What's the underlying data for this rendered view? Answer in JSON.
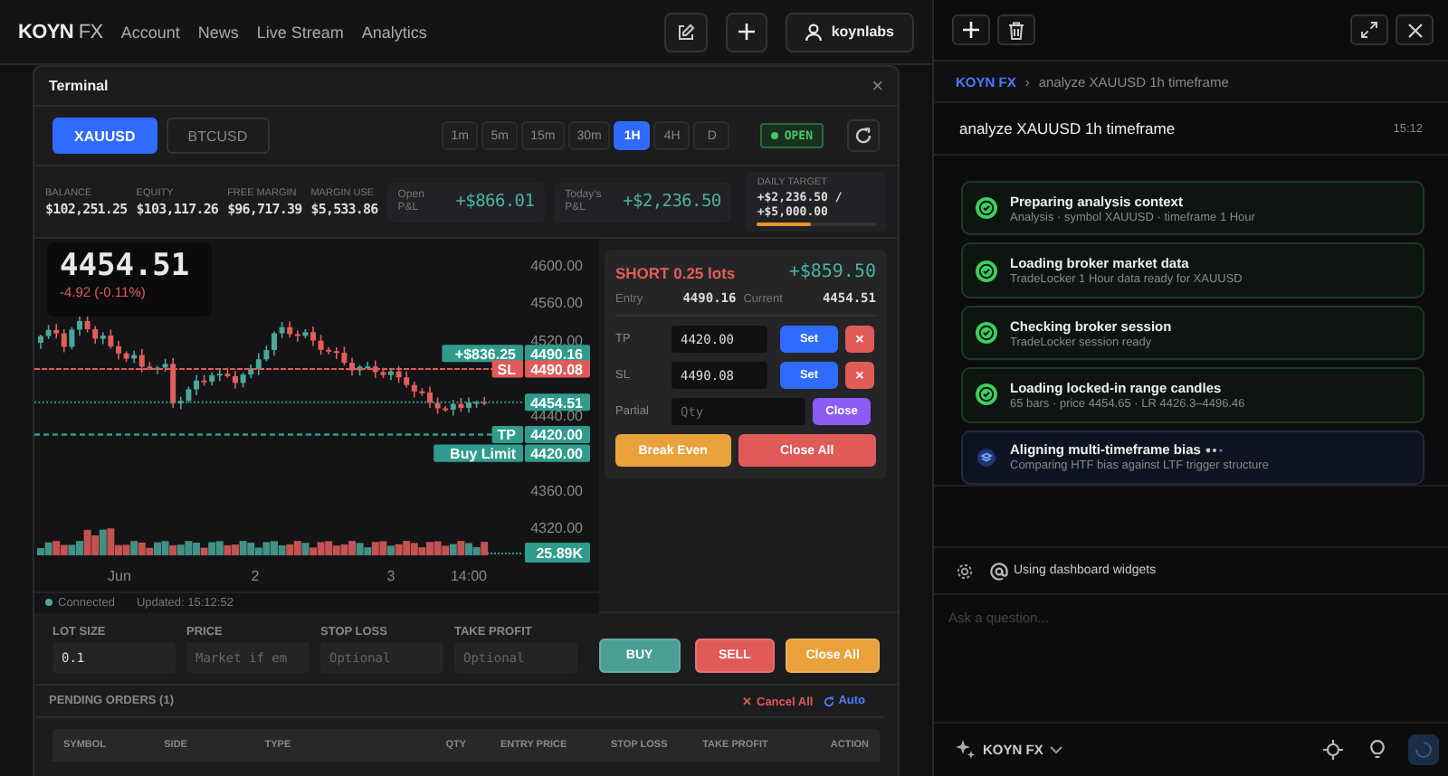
{
  "top_bar": {
    "logo_main": "KOYN",
    "logo_sub": "FX",
    "nav": [
      {
        "label": "Account"
      },
      {
        "label": "News"
      },
      {
        "label": "Live Stream"
      },
      {
        "label": "Analytics"
      }
    ],
    "user": "koynlabs"
  },
  "terminal": {
    "title": "Terminal",
    "close": "×",
    "symbols": [
      {
        "label": "XAUUSD",
        "selected": true
      },
      {
        "label": "BTCUSD",
        "selected": false
      }
    ],
    "timeframes": [
      {
        "label": "1m",
        "selected": false
      },
      {
        "label": "5m",
        "selected": false
      },
      {
        "label": "15m",
        "selected": false
      },
      {
        "label": "30m",
        "selected": false
      },
      {
        "label": "1H",
        "selected": true
      },
      {
        "label": "4H",
        "selected": false
      },
      {
        "label": "D",
        "selected": false
      }
    ],
    "market_status": "OPEN",
    "stats": [
      {
        "label": "BALANCE",
        "value": "$102,251.25"
      },
      {
        "label": "EQUITY",
        "value": "$103,117.26"
      },
      {
        "label": "FREE MARGIN",
        "value": "$96,717.39"
      },
      {
        "label": "MARGIN USE",
        "value": "$5,533.86"
      }
    ],
    "pnl": [
      {
        "label": "Open P&L",
        "value": "+$866.01"
      },
      {
        "label": "Today's P&L",
        "value": "+$2,236.50"
      }
    ],
    "daily_target": {
      "label": "DAILY TARGET",
      "value": "+$2,236.50 / +$5,000.00",
      "level": 0.45
    },
    "chart": {
      "price": "4454.51",
      "change": "-4.92 (-0.11%)",
      "y_axis_labels": [
        "4600.00",
        "4560.00",
        "4520.00",
        "4440.00",
        "4360.00",
        "4320.00"
      ],
      "x_axis_labels": [
        "Jun",
        "2",
        "3",
        "14:00"
      ],
      "price_tags": [
        {
          "kind": "position",
          "label": "+$836.25",
          "value": "4490.16"
        },
        {
          "kind": "stop",
          "label": "SL",
          "value": "4490.08"
        },
        {
          "kind": "current",
          "value": "4454.51"
        },
        {
          "kind": "target",
          "label": "TP",
          "value": "4420.00"
        },
        {
          "kind": "order",
          "label": "Buy Limit",
          "value": "4420.00"
        }
      ],
      "volume_tag": "25.89K",
      "connection": "Connected",
      "updated": "Updated: 15:12:52"
    },
    "position": {
      "side": "SHORT 0.25 lots",
      "pnl": "+$859.50",
      "entry_label": "Entry",
      "entry": "4490.16",
      "current_label": "Current",
      "current": "4454.51",
      "rows": [
        {
          "label": "TP",
          "value": "4420.00",
          "set": "Set",
          "clear": "×"
        },
        {
          "label": "SL",
          "value": "4490.08",
          "set": "Set",
          "clear": "×"
        }
      ],
      "partial": {
        "label": "Partial",
        "placeholder": "Qty",
        "button": "Close"
      },
      "break_even": "Break Even",
      "close_all": "Close All"
    },
    "order_form": {
      "fields": [
        {
          "label": "LOT SIZE",
          "value": "0.1"
        },
        {
          "label": "PRICE",
          "placeholder": "Market if em"
        },
        {
          "label": "STOP LOSS",
          "placeholder": "Optional"
        },
        {
          "label": "TAKE PROFIT",
          "placeholder": "Optional"
        }
      ],
      "buttons": [
        {
          "kind": "buy",
          "label": "BUY"
        },
        {
          "kind": "sell",
          "label": "SELL"
        },
        {
          "kind": "close",
          "label": "Close All"
        }
      ]
    },
    "pending_orders": {
      "title": "PENDING ORDERS (1)",
      "cancel_all": "✕ Cancel All",
      "auto": "Auto",
      "columns": [
        "SYMBOL",
        "SIDE",
        "TYPE",
        "QTY",
        "ENTRY PRICE",
        "STOP LOSS",
        "TAKE PROFIT",
        "ACTION"
      ]
    }
  },
  "chat": {
    "breadcrumb": {
      "root": "KOYN FX",
      "separator": "›",
      "current": "analyze XAUUSD 1h timeframe"
    },
    "message": {
      "text": "analyze XAUUSD 1h timeframe",
      "time": "15:12"
    },
    "steps": [
      {
        "kind": "done",
        "title": "Preparing analysis context",
        "detail": "Analysis · symbol XAUUSD · timeframe 1 Hour"
      },
      {
        "kind": "done",
        "title": "Loading broker market data",
        "detail": "TradeLocker 1 Hour data ready for XAUUSD"
      },
      {
        "kind": "done",
        "title": "Checking broker session",
        "detail": "TradeLocker session ready"
      },
      {
        "kind": "done",
        "title": "Loading locked-in range candles",
        "detail": "65 bars · price 4454.65 · LR 4426.3–4496.46"
      },
      {
        "kind": "running",
        "title": "Aligning multi-timeframe bias",
        "detail": "Comparing HTF bias against LTF trigger structure"
      }
    ],
    "context": "Using dashboard widgets",
    "input_placeholder": "Ask a question...",
    "model": "KOYN FX"
  }
}
